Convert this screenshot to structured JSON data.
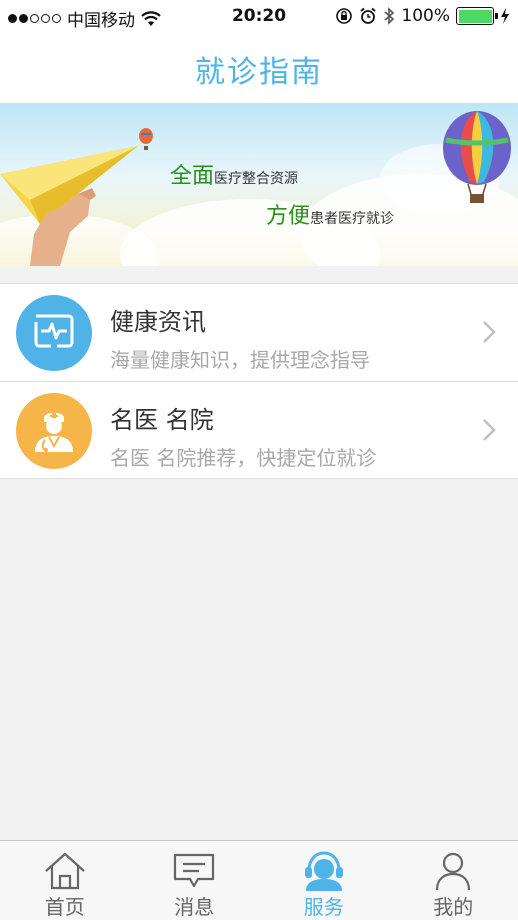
{
  "status_bar": {
    "carrier": "中国移动",
    "time": "20:20",
    "battery": "100%"
  },
  "nav": {
    "title": "就诊指南"
  },
  "banner": {
    "line1_em": "全面",
    "line1_rest": "医疗整合资源",
    "line2_em": "方便",
    "line2_rest": "患者医疗就诊"
  },
  "list": [
    {
      "title": "健康资讯",
      "subtitle": "海量健康知识，提供理念指导",
      "icon": "health-monitor-icon",
      "color": "#4fb3e8"
    },
    {
      "title": "名医 名院",
      "subtitle": "名医 名院推荐，快捷定位就诊",
      "icon": "doctor-icon",
      "color": "#f5b549"
    }
  ],
  "tabs": [
    {
      "label": "首页",
      "icon": "home-icon",
      "active": false
    },
    {
      "label": "消息",
      "icon": "message-icon",
      "active": false
    },
    {
      "label": "服务",
      "icon": "service-icon",
      "active": true
    },
    {
      "label": "我的",
      "icon": "profile-icon",
      "active": false
    }
  ],
  "colors": {
    "accent": "#4fb3e8",
    "green": "#2b8f1d",
    "orange": "#f5b549"
  }
}
